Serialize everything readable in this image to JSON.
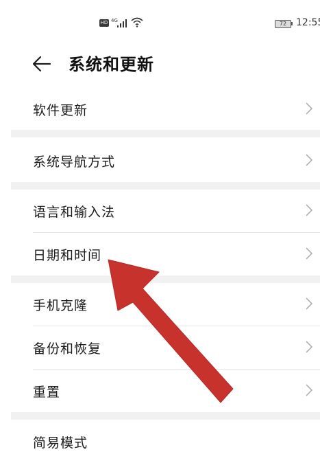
{
  "status_bar": {
    "hd_label": "HD",
    "network": "4G",
    "battery": "72",
    "time": "12:55"
  },
  "header": {
    "title": "系统和更新"
  },
  "items": [
    {
      "label": "软件更新"
    },
    {
      "label": "系统导航方式"
    },
    {
      "label": "语言和输入法"
    },
    {
      "label": "日期和时间"
    },
    {
      "label": "手机克隆"
    },
    {
      "label": "备份和恢复"
    },
    {
      "label": "重置"
    },
    {
      "label": "简易模式"
    }
  ],
  "annotation": {
    "type": "red-arrow",
    "color": "#c8322d",
    "points_to": "日期和时间"
  }
}
